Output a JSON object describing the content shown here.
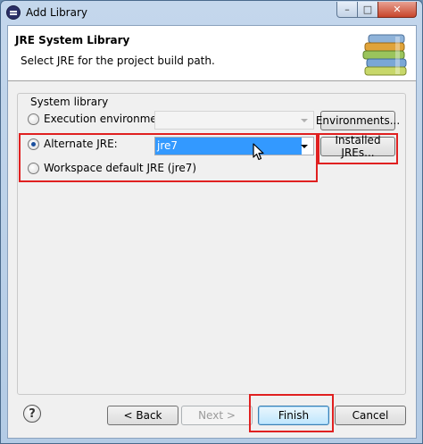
{
  "window": {
    "title": "Add Library",
    "minimize_glyph": "–",
    "maximize_glyph": "□",
    "close_glyph": "✕"
  },
  "header": {
    "title": "JRE System Library",
    "subtitle": "Select JRE for the project build path.",
    "banner_icon": "books-icon"
  },
  "system_library": {
    "legend": "System library",
    "execution_environment": {
      "label": "Execution environment:",
      "selected": false,
      "combo_value": "",
      "combo_enabled": false,
      "button_label": "Environments..."
    },
    "alternate_jre": {
      "label": "Alternate JRE:",
      "selected": true,
      "combo_value": "jre7",
      "button_label": "Installed JREs..."
    },
    "workspace_default": {
      "label": "Workspace default JRE (jre7)",
      "selected": false
    }
  },
  "footer": {
    "help_glyph": "?",
    "back_label": "< Back",
    "next_label": "Next >",
    "finish_label": "Finish",
    "cancel_label": "Cancel"
  },
  "colors": {
    "highlight": "#e02020",
    "selection": "#3399ff"
  }
}
